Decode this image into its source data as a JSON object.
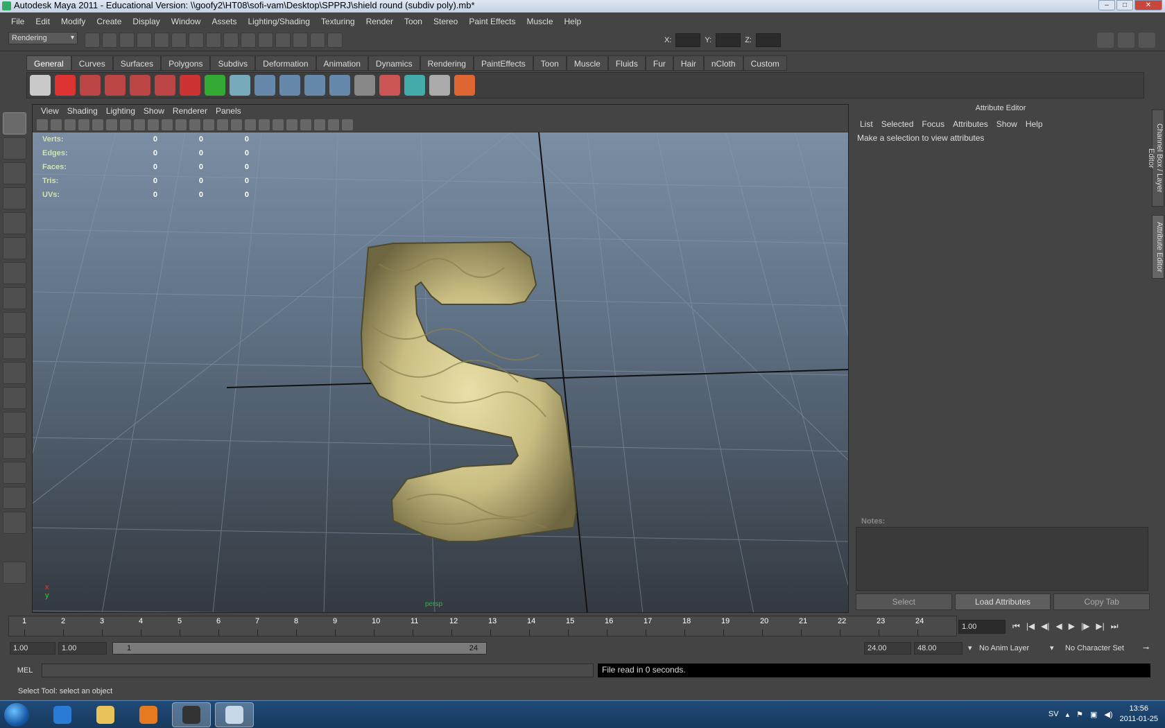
{
  "window": {
    "title": "Autodesk Maya 2011 - Educational Version: \\\\goofy2\\HT08\\sofi-vam\\Desktop\\SPPRJ\\shield round (subdiv poly).mb*"
  },
  "menu": [
    "File",
    "Edit",
    "Modify",
    "Create",
    "Display",
    "Window",
    "Assets",
    "Lighting/Shading",
    "Texturing",
    "Render",
    "Toon",
    "Stereo",
    "Paint Effects",
    "Muscle",
    "Help"
  ],
  "status_line": {
    "mode": "Rendering",
    "x_label": "X:",
    "y_label": "Y:",
    "z_label": "Z:"
  },
  "shelf_tabs": [
    "General",
    "Curves",
    "Surfaces",
    "Polygons",
    "Subdivs",
    "Deformation",
    "Animation",
    "Dynamics",
    "Rendering",
    "PaintEffects",
    "Toon",
    "Muscle",
    "Fluids",
    "Fur",
    "Hair",
    "nCloth",
    "Custom"
  ],
  "viewport": {
    "menu": [
      "View",
      "Shading",
      "Lighting",
      "Show",
      "Renderer",
      "Panels"
    ],
    "hud": [
      {
        "label": "Verts:",
        "v1": "0",
        "v2": "0",
        "v3": "0"
      },
      {
        "label": "Edges:",
        "v1": "0",
        "v2": "0",
        "v3": "0"
      },
      {
        "label": "Faces:",
        "v1": "0",
        "v2": "0",
        "v3": "0"
      },
      {
        "label": "Tris:",
        "v1": "0",
        "v2": "0",
        "v3": "0"
      },
      {
        "label": "UVs:",
        "v1": "0",
        "v2": "0",
        "v3": "0"
      }
    ],
    "camera": "persp",
    "axis": {
      "x": "x",
      "y": "y"
    }
  },
  "attribute_editor": {
    "title": "Attribute Editor",
    "menu": [
      "List",
      "Selected",
      "Focus",
      "Attributes",
      "Show",
      "Help"
    ],
    "message": "Make a selection to view attributes",
    "notes_label": "Notes:",
    "buttons": {
      "select": "Select",
      "load": "Load Attributes",
      "copy": "Copy Tab"
    }
  },
  "side_tabs": {
    "channel": "Channel Box / Layer Editor",
    "attr": "Attribute Editor"
  },
  "time_slider": {
    "ticks": [
      "1",
      "2",
      "3",
      "4",
      "5",
      "6",
      "7",
      "8",
      "9",
      "10",
      "11",
      "12",
      "13",
      "14",
      "15",
      "16",
      "17",
      "18",
      "19",
      "20",
      "21",
      "22",
      "23",
      "24"
    ],
    "current": "1.00"
  },
  "range": {
    "start": "1.00",
    "inner_start": "1.00",
    "bar_start": "1",
    "bar_end": "24",
    "end": "24.00",
    "outer_end": "48.00",
    "anim_layer": "No Anim Layer",
    "char_set": "No Character Set"
  },
  "command": {
    "label": "MEL",
    "output": "File read in 0 seconds."
  },
  "help_line": "Select Tool: select an object",
  "taskbar": {
    "lang": "SV",
    "time": "13:56",
    "date": "2011-01-25"
  }
}
